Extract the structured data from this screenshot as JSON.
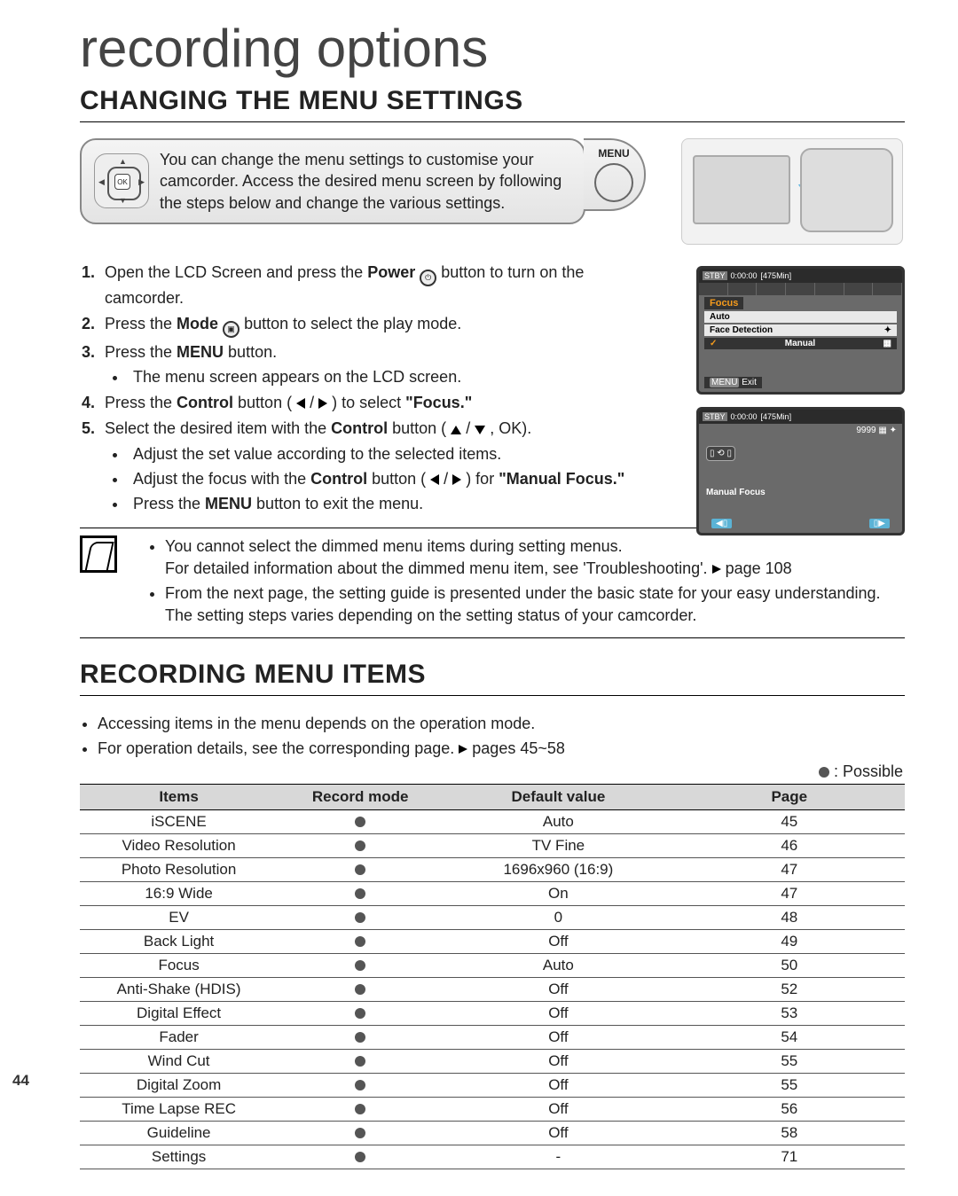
{
  "page_number": "44",
  "page_title": "recording options",
  "section1": {
    "heading": "CHANGING THE MENU SETTINGS",
    "intro": "You can change the menu settings to customise your camcorder. Access the desired menu screen by following the steps below and change the various settings.",
    "menu_label": "MENU",
    "dpad_ok": "OK"
  },
  "steps": {
    "s1a": "Open the LCD Screen and press the ",
    "s1b": "Power",
    "s1c": " button to turn on the camcorder.",
    "s2a": "Press the ",
    "s2b": "Mode",
    "s2c": " button to select the play mode.",
    "s3a": "Press the ",
    "s3b": "MENU",
    "s3c": " button.",
    "s3_1": "The menu screen appears on the LCD screen.",
    "s4a": "Press the ",
    "s4b": "Control",
    "s4c": " button (",
    "s4d": ") to select ",
    "s4e": "\"Focus.\"",
    "s5a": "Select the desired item with the ",
    "s5b": "Control",
    "s5c": " button (",
    "s5d": ", OK).",
    "s5_1": "Adjust the set value according to the selected items.",
    "s5_2a": "Adjust the focus with the ",
    "s5_2b": "Control",
    "s5_2c": " button (",
    "s5_2d": ") for ",
    "s5_2e": "\"Manual Focus.\"",
    "s5_3a": "Press the ",
    "s5_3b": "MENU",
    "s5_3c": " button to exit the menu."
  },
  "notes": {
    "n1a": "You cannot select the dimmed menu items during setting menus.",
    "n1b": "For detailed information about the dimmed menu item, see 'Troubleshooting'. ",
    "n1c": "page 108",
    "n2": "From the next page, the setting guide is presented under the basic state for your easy understanding. The setting steps varies depending on the setting status of your camcorder."
  },
  "section2": {
    "heading": "RECORDING MENU ITEMS",
    "intro1": "Accessing items in the menu depends on the operation mode.",
    "intro2a": "For operation details, see the corresponding page. ",
    "intro2b": "pages 45~58",
    "legend": " : Possible",
    "headers": [
      "Items",
      "Record mode",
      "Default value",
      "Page"
    ],
    "rows": [
      {
        "item": "iSCENE",
        "rec": true,
        "def": "Auto",
        "page": "45"
      },
      {
        "item": "Video Resolution",
        "rec": true,
        "def": "TV Fine",
        "page": "46"
      },
      {
        "item": "Photo Resolution",
        "rec": true,
        "def": "1696x960 (16:9)",
        "page": "47"
      },
      {
        "item": "16:9 Wide",
        "rec": true,
        "def": "On",
        "page": "47"
      },
      {
        "item": "EV",
        "rec": true,
        "def": "0",
        "page": "48"
      },
      {
        "item": "Back Light",
        "rec": true,
        "def": "Off",
        "page": "49"
      },
      {
        "item": "Focus",
        "rec": true,
        "def": "Auto",
        "page": "50"
      },
      {
        "item": "Anti-Shake (HDIS)",
        "rec": true,
        "def": "Off",
        "page": "52"
      },
      {
        "item": "Digital Effect",
        "rec": true,
        "def": "Off",
        "page": "53"
      },
      {
        "item": "Fader",
        "rec": true,
        "def": "Off",
        "page": "54"
      },
      {
        "item": "Wind Cut",
        "rec": true,
        "def": "Off",
        "page": "55"
      },
      {
        "item": "Digital Zoom",
        "rec": true,
        "def": "Off",
        "page": "55"
      },
      {
        "item": "Time Lapse REC",
        "rec": true,
        "def": "Off",
        "page": "56"
      },
      {
        "item": "Guideline",
        "rec": true,
        "def": "Off",
        "page": "58"
      },
      {
        "item": "Settings",
        "rec": true,
        "def": "-",
        "page": "71"
      }
    ]
  },
  "lcd1": {
    "stby": "STBY",
    "time": "0:00:00",
    "remain": "[475Min]",
    "title": "Focus",
    "opt1": "Auto",
    "opt2": "Face Detection",
    "opt3": "Manual",
    "exit": "Exit",
    "menu": "MENU"
  },
  "lcd2": {
    "stby": "STBY",
    "time": "0:00:00",
    "remain": "[475Min]",
    "count": "9999",
    "label": "Manual Focus"
  }
}
